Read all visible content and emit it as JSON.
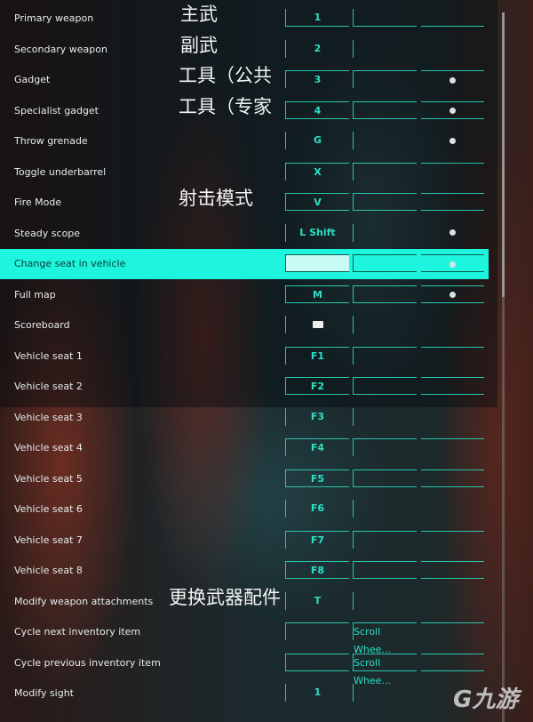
{
  "colors": {
    "accent": "#2de0c6",
    "highlight": "#1ef5de"
  },
  "rows": [
    {
      "label": "Primary weapon",
      "key1": "1",
      "note": "主武"
    },
    {
      "label": "Secondary weapon",
      "key1": "2",
      "note": "副武"
    },
    {
      "label": "Gadget",
      "key1": "3",
      "note": "工具（公共",
      "key3_icon": "mouse-button-icon"
    },
    {
      "label": "Specialist gadget",
      "key1": "4",
      "note": "工具（专家",
      "key3_icon": "mouse-button-icon"
    },
    {
      "label": "Throw grenade",
      "key1": "G",
      "key3_icon": "mouse-button-icon"
    },
    {
      "label": "Toggle underbarrel",
      "key1": "X"
    },
    {
      "label": "Fire Mode",
      "key1": "V",
      "note": "射击模式"
    },
    {
      "label": "Steady scope",
      "key1": "L Shift",
      "key3_icon": "mouse-button-icon"
    },
    {
      "label": "Change seat in vehicle",
      "key1": "",
      "key3_icon": "mouse-button-icon"
    },
    {
      "label": "Full map",
      "key1": "M",
      "key3_icon": "mouse-button-icon"
    },
    {
      "label": "Scoreboard",
      "key1_icon": "keyboard-icon"
    },
    {
      "label": "Vehicle seat 1",
      "key1": "F1"
    },
    {
      "label": "Vehicle seat 2",
      "key1": "F2"
    },
    {
      "label": "Vehicle seat 3",
      "key1": "F3"
    },
    {
      "label": "Vehicle seat 4",
      "key1": "F4"
    },
    {
      "label": "Vehicle seat 5",
      "key1": "F5"
    },
    {
      "label": "Vehicle seat 6",
      "key1": "F6"
    },
    {
      "label": "Vehicle seat 7",
      "key1": "F7"
    },
    {
      "label": "Vehicle seat 8",
      "key1": "F8"
    },
    {
      "label": "Modify weapon attachments",
      "key1": "T",
      "note": "更换武器配件"
    },
    {
      "label": "Cycle next inventory item",
      "key1": "",
      "key2": "Scroll Whee..."
    },
    {
      "label": "Cycle previous inventory item",
      "key1": "",
      "key2": "Scroll Whee..."
    },
    {
      "label": "Modify sight",
      "key1": "1"
    }
  ],
  "watermark": "九游"
}
